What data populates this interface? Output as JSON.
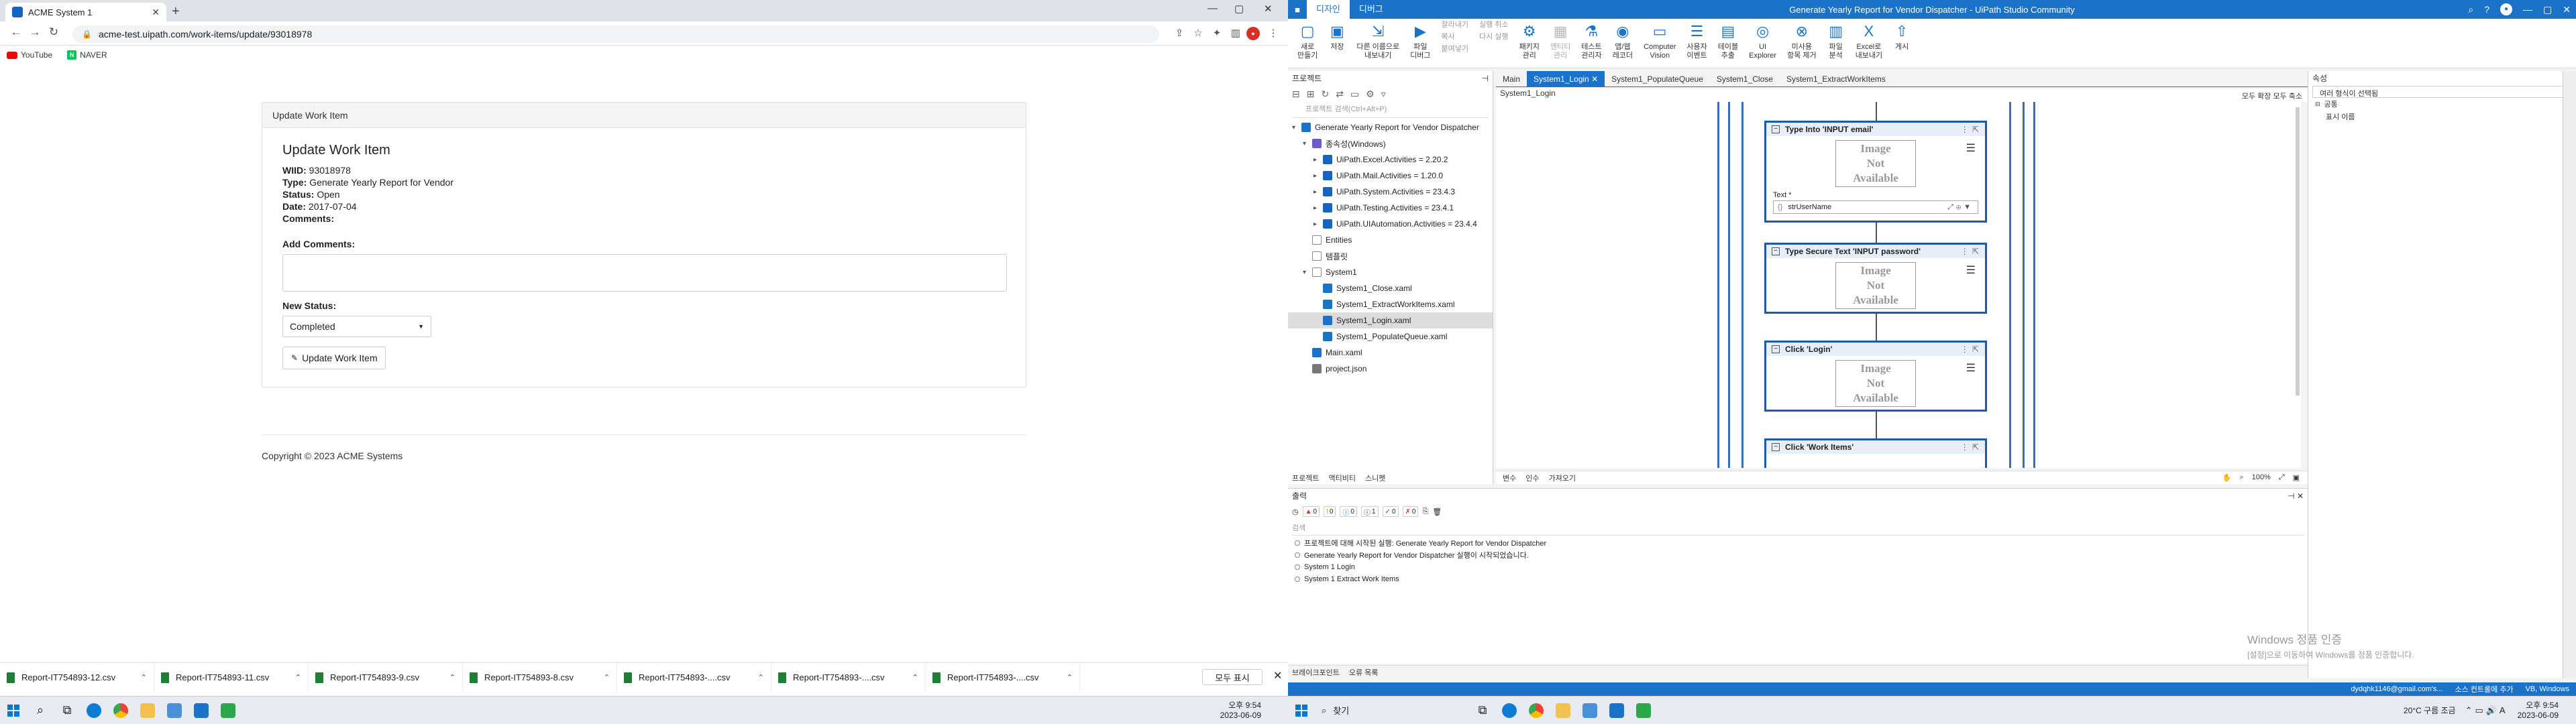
{
  "browser": {
    "tab_title": "ACME System 1",
    "url": "acme-test.uipath.com/work-items/update/93018978",
    "bookmarks": [
      "YouTube",
      "NAVER"
    ]
  },
  "page": {
    "panel_heading": "Update Work Item",
    "title": "Update Work Item",
    "fields": [
      {
        "label": "WIID:",
        "value": "93018978"
      },
      {
        "label": "Type:",
        "value": "Generate Yearly Report for Vendor"
      },
      {
        "label": "Status:",
        "value": "Open"
      },
      {
        "label": "Date:",
        "value": "2017-07-04"
      },
      {
        "label": "Comments:",
        "value": ""
      }
    ],
    "add_comments_label": "Add Comments:",
    "new_status_label": "New Status:",
    "status_value": "Completed",
    "update_button": "Update Work Item",
    "footer": "Copyright © 2023 ACME Systems"
  },
  "downloads": {
    "items": [
      "Report-IT754893-12.csv",
      "Report-IT754893-11.csv",
      "Report-IT754893-9.csv",
      "Report-IT754893-8.csv",
      "Report-IT754893-....csv",
      "Report-IT754893-....csv",
      "Report-IT754893-....csv"
    ],
    "show_all": "모두 표시"
  },
  "taskbar_left": {
    "time": "오후 9:54",
    "date": "2023-06-09"
  },
  "taskbar_right": {
    "search": "찾기",
    "weather": "20°C 구름 조금",
    "time": "오후 9:54",
    "date": "2023-06-09"
  },
  "studio": {
    "ribbon_tabs": [
      "디자인",
      "디버그"
    ],
    "app_title": "Generate Yearly Report for Vendor Dispatcher - UiPath Studio Community",
    "ribbon_buttons": [
      {
        "label": "새로\n만들기",
        "icon": "new-file-icon",
        "glyph": "▢"
      },
      {
        "label": "저장",
        "icon": "save-icon",
        "glyph": "▣"
      },
      {
        "label": "다른 이름으로\n내보내기",
        "icon": "export-icon",
        "glyph": "⇲"
      },
      {
        "label": "파일\n디버그",
        "icon": "debug-play-icon",
        "glyph": "▶"
      }
    ],
    "ribbon_small": [
      "잘라내기",
      "복사",
      "붙여넣기",
      "실행 취소",
      "다시 실행"
    ],
    "ribbon_buttons2": [
      {
        "label": "패키지\n관리",
        "icon": "package-icon",
        "glyph": "⚙",
        "dis": false
      },
      {
        "label": "엔티티\n관리",
        "icon": "entity-icon",
        "glyph": "▦",
        "dis": true
      },
      {
        "label": "테스트\n관리자",
        "icon": "test-manager-icon",
        "glyph": "⚗",
        "dis": false
      },
      {
        "label": "앱/웹\n레코더",
        "icon": "recorder-icon",
        "glyph": "◉",
        "dis": false
      },
      {
        "label": "Computer\nVision",
        "icon": "computer-vision-icon",
        "glyph": "▭",
        "dis": false
      },
      {
        "label": "사용자\n이벤트",
        "icon": "user-events-icon",
        "glyph": "☰",
        "dis": false
      },
      {
        "label": "테이블\n추출",
        "icon": "table-extract-icon",
        "glyph": "▤",
        "dis": false
      },
      {
        "label": "UI\nExplorer",
        "icon": "ui-explorer-icon",
        "glyph": "◎",
        "dis": false
      },
      {
        "label": "미사용\n항목 제거",
        "icon": "remove-unused-icon",
        "glyph": "⊗",
        "dis": false
      },
      {
        "label": "파일\n분석",
        "icon": "analyze-icon",
        "glyph": "▥",
        "dis": false
      },
      {
        "label": "Excel로\n내보내기",
        "icon": "excel-export-icon",
        "glyph": "X",
        "dis": false
      },
      {
        "label": "게시",
        "icon": "publish-icon",
        "glyph": "⇧",
        "dis": false
      }
    ],
    "project_pane_title": "프로젝트",
    "project_search": "프로젝트 검색(Ctrl+Alt+P)",
    "tree": [
      {
        "label": "Generate Yearly Report for Vendor Dispatcher",
        "indent": 0,
        "caret": "▾",
        "kind": "project",
        "sel": false
      },
      {
        "label": "종속성(Windows)",
        "indent": 1,
        "caret": "▾",
        "kind": "deps",
        "sel": false
      },
      {
        "label": "UiPath.Excel.Activities = 2.20.2",
        "indent": 2,
        "caret": "▸",
        "kind": "pkg",
        "sel": false
      },
      {
        "label": "UiPath.Mail.Activities = 1.20.0",
        "indent": 2,
        "caret": "▸",
        "kind": "pkg",
        "sel": false
      },
      {
        "label": "UiPath.System.Activities = 23.4.3",
        "indent": 2,
        "caret": "▸",
        "kind": "pkg",
        "sel": false
      },
      {
        "label": "UiPath.Testing.Activities = 23.4.1",
        "indent": 2,
        "caret": "▸",
        "kind": "pkg",
        "sel": false
      },
      {
        "label": "UiPath.UIAutomation.Activities = 23.4.4",
        "indent": 2,
        "caret": "▸",
        "kind": "pkg",
        "sel": false
      },
      {
        "label": "Entities",
        "indent": 1,
        "caret": "",
        "kind": "folder",
        "sel": false
      },
      {
        "label": "템플릿",
        "indent": 1,
        "caret": "",
        "kind": "folder",
        "sel": false
      },
      {
        "label": "System1",
        "indent": 1,
        "caret": "▾",
        "kind": "folder",
        "sel": false
      },
      {
        "label": "System1_Close.xaml",
        "indent": 2,
        "caret": "",
        "kind": "xaml",
        "sel": false
      },
      {
        "label": "System1_ExtractWorkItems.xaml",
        "indent": 2,
        "caret": "",
        "kind": "xaml",
        "sel": false
      },
      {
        "label": "System1_Login.xaml",
        "indent": 2,
        "caret": "",
        "kind": "xaml",
        "sel": true
      },
      {
        "label": "System1_PopulateQueue.xaml",
        "indent": 2,
        "caret": "",
        "kind": "xaml",
        "sel": false
      },
      {
        "label": "Main.xaml",
        "indent": 1,
        "caret": "",
        "kind": "xaml",
        "sel": false
      },
      {
        "label": "project.json",
        "indent": 1,
        "caret": "",
        "kind": "json",
        "sel": false
      }
    ],
    "left_bottom_tabs": [
      "프로젝트",
      "액티비티",
      "스니펫"
    ],
    "doc_tabs": [
      "Main",
      "System1_Login",
      "System1_PopulateQueue",
      "System1_Close",
      "System1_ExtractWorkItems"
    ],
    "active_doc": 1,
    "breadcrumb": "System1_Login",
    "breadcrumb_right": "모두 확장   모두 축소",
    "activities": [
      {
        "title": "Type Into 'INPUT  email'",
        "image_text": "Image\nNot\nAvailable",
        "field_label": "Text *",
        "field_value": "strUserName"
      },
      {
        "title": "Type Secure Text 'INPUT  password'",
        "image_text": "Image\nNot\nAvailable"
      },
      {
        "title": "Click 'Login'",
        "image_text": "Image\nNot\nAvailable"
      },
      {
        "title": "Click 'Work Items'"
      }
    ],
    "canvas_bottom": [
      "변수",
      "인수",
      "가져오기"
    ],
    "zoom": "100%",
    "output_title": "출력",
    "output_counts": [
      "0",
      "0",
      "0",
      "1",
      "0",
      "0"
    ],
    "output_search": "검색",
    "output_lines": [
      "프로젝트에 대해 시작된 실행: Generate Yearly Report for Vendor Dispatcher",
      "Generate Yearly Report for Vendor Dispatcher 실행이 시작되었습니다.",
      "System 1 Login",
      "System 1 Extract Work Items"
    ],
    "output_footer": [
      "브레이크포인트",
      "오류 목록"
    ],
    "props_title": "속성",
    "props_sub": "여러 형식이 선택됨",
    "props_items": [
      "공통",
      "표시 이름"
    ],
    "watermark_title": "Windows 정품 인증",
    "watermark_sub": "[설정]으로 이동하여 Windows를 정품 인증합니다.",
    "status_left": "",
    "status_right": [
      "dydqhk1146@gmail.com's...",
      "소스 컨트롤에 추가",
      "VB, Windows"
    ]
  }
}
